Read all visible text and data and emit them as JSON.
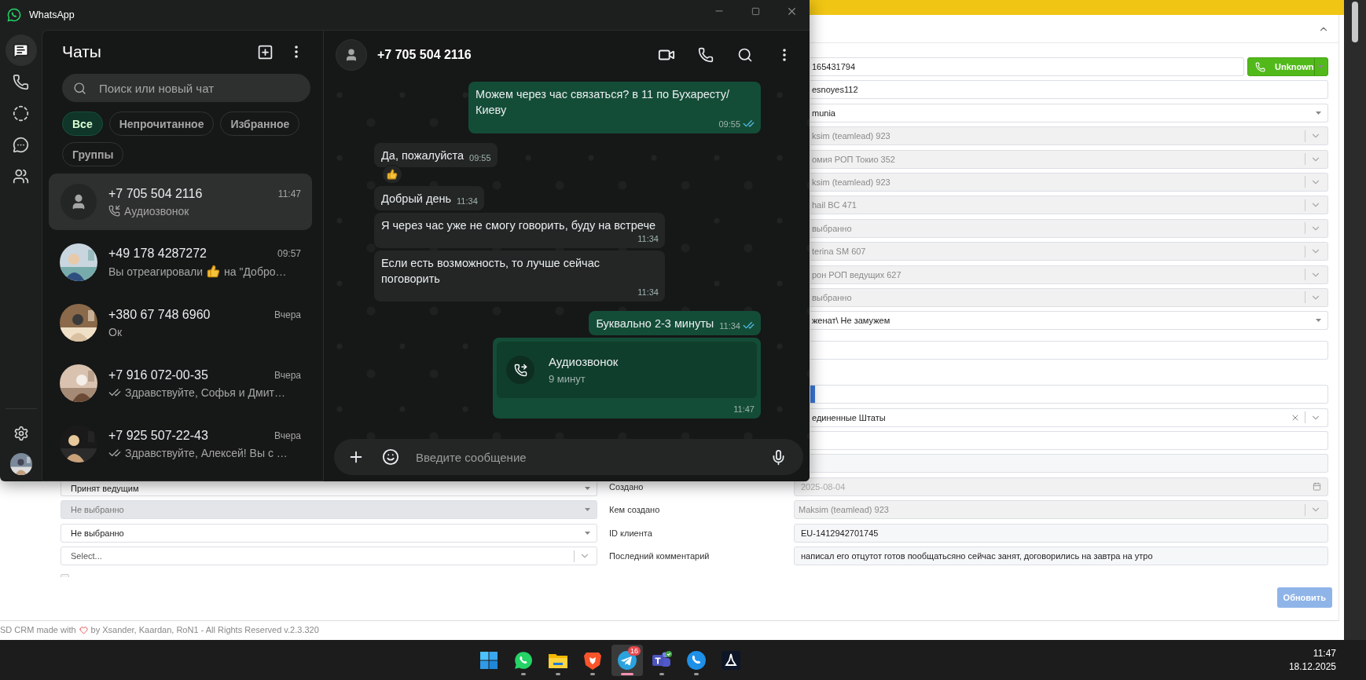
{
  "whatsapp": {
    "title": "WhatsApp",
    "rail": [
      {
        "kind": "chats",
        "selected": true
      },
      {
        "kind": "calls",
        "selected": false
      },
      {
        "kind": "status",
        "selected": false
      },
      {
        "kind": "channels",
        "selected": false
      },
      {
        "kind": "communities",
        "selected": false
      }
    ],
    "rail_bottom": [
      {
        "kind": "settings"
      },
      {
        "kind": "profile"
      }
    ],
    "chat_list": {
      "title": "Чаты",
      "search": {
        "placeholder": "Поиск или новый чат"
      },
      "filters": [
        {
          "label": "Все",
          "selected": true
        },
        {
          "label": "Непрочитанное",
          "selected": false
        },
        {
          "label": "Избранное",
          "selected": false
        },
        {
          "label": "Группы",
          "selected": false
        }
      ],
      "chats": [
        {
          "name": "+7 705 504 2116",
          "time": "11:47",
          "selected": true,
          "photo": false,
          "preview": {
            "kind": "call",
            "text": "Аудиозвонок"
          }
        },
        {
          "name": "+49 178 4287272",
          "time": "09:57",
          "selected": false,
          "photo": true,
          "preview": {
            "kind": "reaction",
            "text": "Вы отреагировали",
            "text_after": "на \"Добро…"
          }
        },
        {
          "name": "+380 67 748 6960",
          "time": "Вчера",
          "selected": false,
          "photo": true,
          "preview": {
            "kind": "text",
            "text": "Ок"
          }
        },
        {
          "name": "+7 916 072-00-35",
          "time": "Вчера",
          "selected": false,
          "photo": true,
          "preview": {
            "kind": "delivered",
            "text": "Здравствуйте, Софья и Дмит…"
          }
        },
        {
          "name": "+7 925 507-22-43",
          "time": "Вчера",
          "selected": false,
          "photo": true,
          "preview": {
            "kind": "delivered",
            "text": "Здравствуйте, Алексей! Вы с …"
          }
        }
      ]
    },
    "chat": {
      "name": "+7 705 504 2116",
      "messages": [
        {
          "kind": "out",
          "text": "Можем через час связаться? в 11 по Бухаресту/ Киеву",
          "time": "09:55",
          "read": true
        },
        {
          "kind": "in",
          "text": "Да, пожалуйста",
          "time": "09:55",
          "reaction": true
        },
        {
          "kind": "in",
          "text": "Добрый день",
          "time": "11:34",
          "reaction": false
        },
        {
          "kind": "in",
          "text": "Я через час уже не смогу говорить, буду на встрече",
          "time": "11:34",
          "reaction": false
        },
        {
          "kind": "in",
          "text": "Если есть возможность, то лучше сейчас поговорить",
          "time": "11:34",
          "reaction": false
        },
        {
          "kind": "out",
          "text": "Буквально 2-3 минуты",
          "time": "11:34",
          "read": true
        },
        {
          "kind": "call",
          "title": "Аудиозвонок",
          "duration": "9 минут",
          "time": "11:47"
        }
      ],
      "composer": {
        "placeholder": "Введите сообщение"
      }
    }
  },
  "crm": {
    "rows": [
      {
        "field": {
          "kind": "phone",
          "value": "165431794",
          "button": "Unknown"
        }
      },
      {
        "field": {
          "kind": "input",
          "value": "esnoyes112"
        }
      },
      {
        "field": {
          "kind": "select",
          "value": "munia"
        }
      },
      {
        "field": {
          "kind": "locked",
          "value": "ksim (teamlead) 923"
        }
      },
      {
        "field": {
          "kind": "locked",
          "value": "омия РОП Токио 352"
        }
      },
      {
        "field": {
          "kind": "locked",
          "value": "ksim (teamlead) 923"
        }
      },
      {
        "field": {
          "kind": "locked",
          "value": "hail BC 471"
        }
      },
      {
        "field": {
          "kind": "locked",
          "value": "выбранно"
        }
      },
      {
        "field": {
          "kind": "locked",
          "value": "terina SM 607"
        }
      },
      {
        "field": {
          "kind": "locked",
          "value": "рон РОП ведущих 627"
        }
      },
      {
        "field": {
          "kind": "locked",
          "value": "выбранно"
        }
      },
      {
        "field": {
          "kind": "select",
          "value": "женат\\ Не замужем"
        }
      },
      {
        "field": {
          "kind": "input"
        }
      },
      {
        "field": {
          "kind": "color"
        }
      },
      {
        "field": {
          "kind": "country",
          "value": "единенные Штаты"
        }
      },
      {
        "field": {
          "kind": "input"
        }
      },
      {
        "field": {
          "kind": "readonly"
        }
      },
      {
        "left": {
          "kind": "select",
          "value": "Принят ведущим",
          "disabled": false
        },
        "label": "Создано",
        "field": {
          "kind": "date",
          "value": "2025-08-04"
        }
      },
      {
        "left": {
          "kind": "select",
          "value": "Не выбранно",
          "disabled": true
        },
        "label": "Кем создано",
        "field": {
          "kind": "locked",
          "value": "Maksim (teamlead) 923"
        }
      },
      {
        "left": {
          "kind": "select",
          "value": "Не выбранно",
          "disabled": false
        },
        "label": "ID клиента",
        "field": {
          "kind": "readonly",
          "value": "EU-1412942701745"
        }
      },
      {
        "left": {
          "kind": "multi",
          "placeholder": "Select..."
        },
        "label": "Последний комментарий",
        "field": {
          "kind": "readonly",
          "value": "написал его отцутот готов пообщатьсяно сейчас занят, договорились на завтра на утро"
        }
      },
      {
        "left": {
          "kind": "checkbox",
          "checked": false
        }
      }
    ],
    "submit": "Обновить",
    "footer": {
      "text": "SD CRM made with",
      "text_after": "by Xsander, Kaardan, RoN1 - All Rights Reserved v.2.3.320"
    }
  },
  "taskbar": {
    "apps": [
      {
        "kind": "start",
        "running": false,
        "selected": false
      },
      {
        "kind": "whatsapp",
        "running": true,
        "selected": false
      },
      {
        "kind": "files",
        "running": true,
        "selected": false
      },
      {
        "kind": "browser",
        "running": true,
        "selected": false
      },
      {
        "kind": "telegram",
        "running": true,
        "selected": true,
        "badge": "16"
      },
      {
        "kind": "teams",
        "running": true,
        "selected": false
      },
      {
        "kind": "phone",
        "running": true,
        "selected": false
      },
      {
        "kind": "pdf",
        "running": false,
        "selected": false
      }
    ],
    "time": "11:47",
    "date": "18.12.2025"
  }
}
